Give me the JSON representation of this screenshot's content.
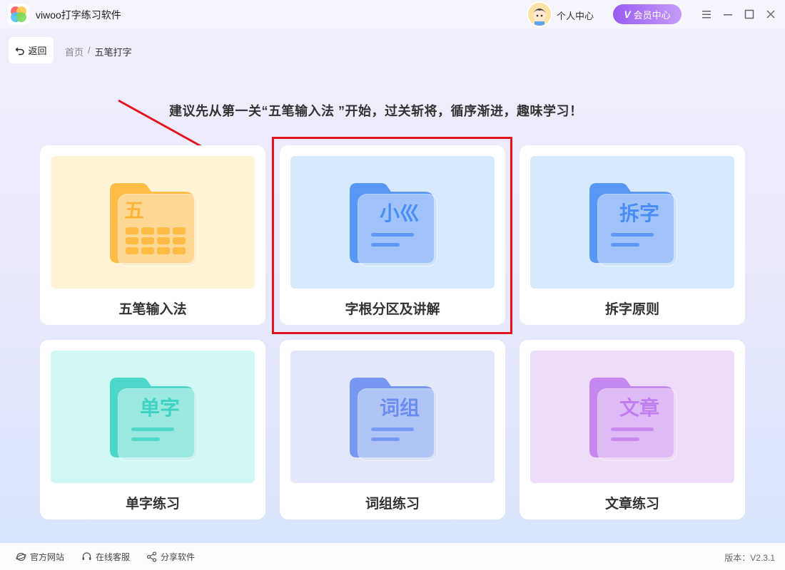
{
  "app": {
    "title": "viwoo打字练习软件"
  },
  "header": {
    "personal_label": "个人中心",
    "vip_label": "会员中心",
    "vip_badge": "V"
  },
  "nav": {
    "back_label": "返回",
    "breadcrumb_home": "首页",
    "breadcrumb_sep": "/",
    "breadcrumb_current": "五笔打字"
  },
  "hint": "建议先从第一关“五笔输入法 ”开始，过关斩将，循序渐进，趣味学习！",
  "cards": [
    {
      "label": "五笔输入法",
      "art_text": "五",
      "bg": "#fff5d6",
      "accent": "#ffb636",
      "icon": "keyboard-folder-icon"
    },
    {
      "label": "字根分区及讲解",
      "art_text": "小巛",
      "bg": "#d9e9fc",
      "accent": "#4a8ef5",
      "icon": "radicals-folder-icon"
    },
    {
      "label": "拆字原则",
      "art_text": "拆字",
      "bg": "#d9e9fc",
      "accent": "#4a8ef5",
      "icon": "split-char-folder-icon"
    },
    {
      "label": "单字练习",
      "art_text": "单字",
      "bg": "#d2f8f6",
      "accent": "#3fd3c4",
      "icon": "single-char-folder-icon"
    },
    {
      "label": "词组练习",
      "art_text": "词组",
      "bg": "#e3e7fa",
      "accent": "#6a8ef0",
      "icon": "phrase-folder-icon"
    },
    {
      "label": "文章练习",
      "art_text": "文章",
      "bg": "#eedcf8",
      "accent": "#c07ef0",
      "icon": "article-folder-icon"
    }
  ],
  "footer": {
    "website": "官方网站",
    "service": "在线客服",
    "share": "分享软件",
    "version": "版本：V2.3.1"
  },
  "colors": {
    "highlight": "#e3141e",
    "vip": "#9a5cf2"
  }
}
